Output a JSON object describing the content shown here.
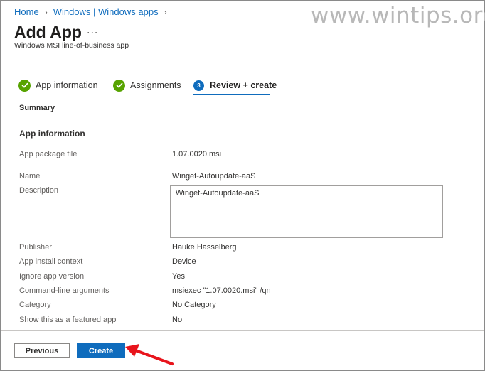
{
  "watermark": "www.wintips.org",
  "breadcrumb": {
    "items": [
      "Home",
      "Windows | Windows apps"
    ]
  },
  "header": {
    "title": "Add App",
    "more_icon": "...",
    "subtitle": "Windows MSI line-of-business app"
  },
  "steps": [
    {
      "label": "App information",
      "status": "complete"
    },
    {
      "label": "Assignments",
      "status": "complete"
    },
    {
      "label": "Review + create",
      "status": "current",
      "number": "3"
    }
  ],
  "summary": {
    "heading": "Summary",
    "section": "App information",
    "rows": [
      {
        "label": "App package file",
        "value": "1.07.0020.msi"
      },
      {
        "label": "Name",
        "value": "Winget-Autoupdate-aaS"
      },
      {
        "label": "Description",
        "value": "Winget-Autoupdate-aaS"
      },
      {
        "label": "Publisher",
        "value": "Hauke Hasselberg"
      },
      {
        "label": "App install context",
        "value": "Device"
      },
      {
        "label": "Ignore app version",
        "value": "Yes"
      },
      {
        "label": "Command-line arguments",
        "value": "msiexec \"1.07.0020.msi\" /qn"
      },
      {
        "label": "Category",
        "value": "No Category"
      },
      {
        "label": "Show this as a featured app",
        "value": "No"
      }
    ]
  },
  "footer": {
    "previous_label": "Previous",
    "create_label": "Create"
  },
  "colors": {
    "accent": "#0f6cbd",
    "success": "#57a300",
    "annotation_arrow": "#e8141c"
  }
}
